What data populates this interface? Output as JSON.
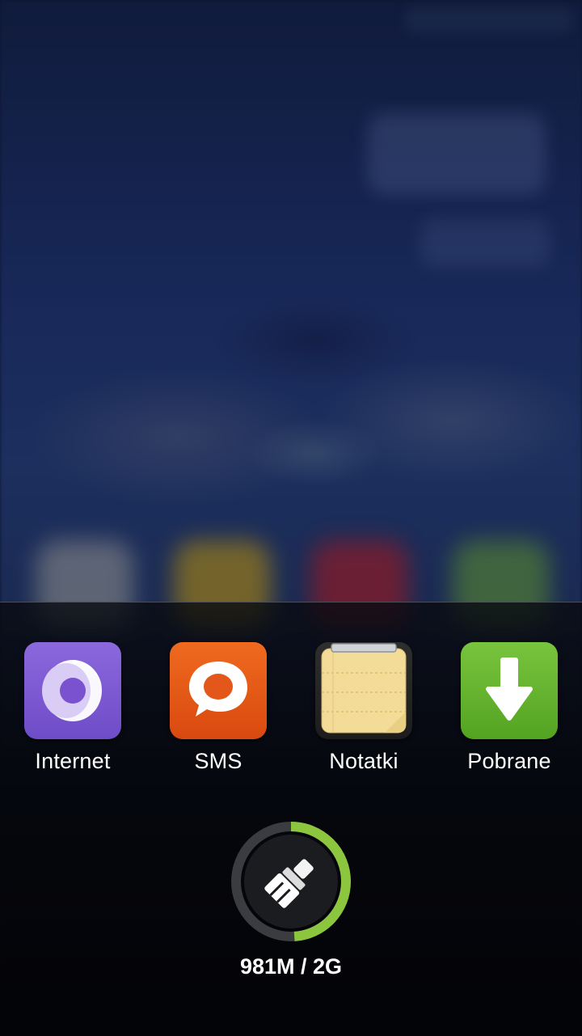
{
  "apps": [
    {
      "label": "Internet",
      "icon": "browser-icon",
      "color": "#7b58d2"
    },
    {
      "label": "SMS",
      "icon": "chat-bubble-icon",
      "color": "#e45a17"
    },
    {
      "label": "Notatki",
      "icon": "notepad-icon",
      "color": "#f2d98f"
    },
    {
      "label": "Pobrane",
      "icon": "download-arrow-icon",
      "color": "#66b42e"
    }
  ],
  "cleaner": {
    "icon": "broom-icon",
    "memory_text": "981M / 2G",
    "used_fraction": 0.49,
    "ring_color": "#8cc63f",
    "track_color": "#3a3c40"
  }
}
